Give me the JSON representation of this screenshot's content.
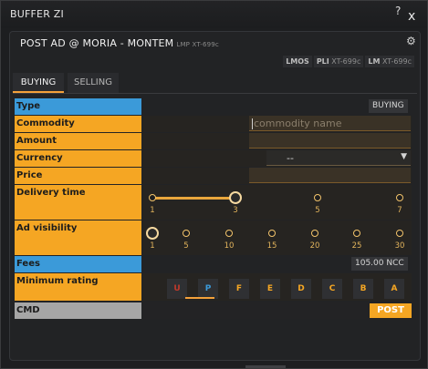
{
  "window": {
    "title": "BUFFER ZI",
    "help": "?",
    "close": "x"
  },
  "panel": {
    "title": "POST AD @ MORIA - MONTEM",
    "subtitle": "LMP XT-699c"
  },
  "tags": [
    {
      "bold": "LMOS",
      "rest": ""
    },
    {
      "bold": "PLI",
      "rest": "XT-699c"
    },
    {
      "bold": "LM",
      "rest": "XT-699c"
    }
  ],
  "tabs": [
    "BUYING",
    "SELLING"
  ],
  "form": {
    "type": {
      "label": "Type",
      "value": "BUYING"
    },
    "commodity": {
      "label": "Commodity",
      "placeholder": "commodity name"
    },
    "amount": {
      "label": "Amount"
    },
    "currency": {
      "label": "Currency",
      "value": "--"
    },
    "price": {
      "label": "Price"
    },
    "delivery": {
      "label": "Delivery time",
      "options": [
        "1",
        "3",
        "5",
        "7"
      ],
      "selected": "3"
    },
    "visibility": {
      "label": "Ad visibility",
      "options": [
        "1",
        "5",
        "10",
        "15",
        "20",
        "25",
        "30"
      ],
      "selected": "1"
    },
    "fees": {
      "label": "Fees",
      "value": "105.00 NCC"
    },
    "rating": {
      "label": "Minimum rating",
      "options": [
        "U",
        "P",
        "F",
        "E",
        "D",
        "C",
        "B",
        "A"
      ],
      "selected": "P"
    },
    "cmd": {
      "label": "CMD",
      "button": "POST"
    }
  },
  "colors": {
    "accent": "#f5a623",
    "label_blue": "#3b9ad9",
    "label_gray": "#a6a6a6",
    "rating_U": "#c0392b",
    "rating_P": "#3b9ad9",
    "rating_other": "#f5a623"
  }
}
